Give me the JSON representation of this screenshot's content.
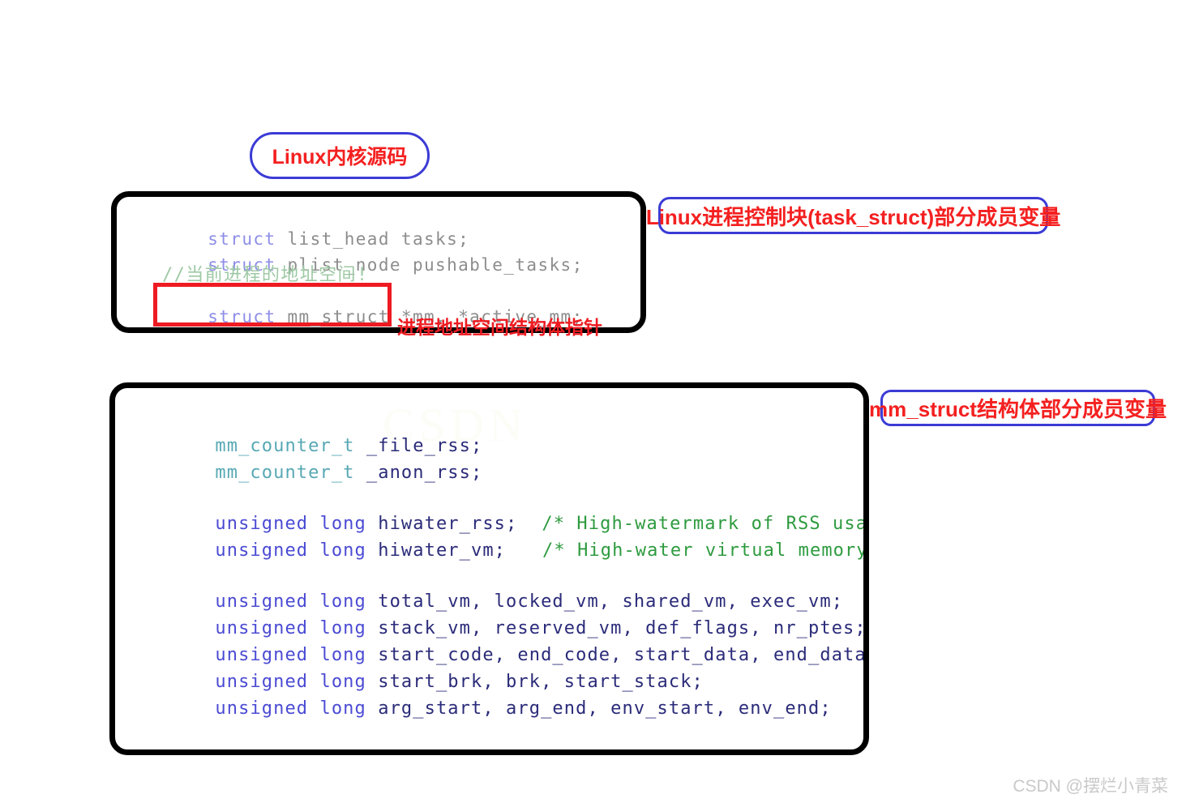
{
  "callouts": {
    "kernel_source": "Linux内核源码",
    "task_struct": "Linux进程控制块(task_struct)部分成员变量",
    "mm_struct": "mm_struct结构体部分成员变量"
  },
  "annotations": {
    "pointer_note": "进程地址空间结构体指针"
  },
  "task_struct_panel": {
    "lines": [
      {
        "keyword": "struct",
        "rest": " list_head tasks;"
      },
      {
        "keyword": "struct",
        "rest": " plist_node pushable_tasks;"
      },
      {
        "comment": "//当前进程的地址空间!"
      },
      {
        "keyword": "struct",
        "rest": " mm_struct *mm, *active_mm;"
      }
    ]
  },
  "mm_struct_panel": {
    "watermark": "CSDN",
    "lines": [
      {
        "type": "mm_counter_t",
        "decl": " _file_rss;",
        "comment": ""
      },
      {
        "type": "mm_counter_t",
        "decl": " _anon_rss;",
        "comment": ""
      },
      {
        "type": "unsigned long",
        "decl": " hiwater_rss;",
        "comment": "/* High-watermark of RSS usage */"
      },
      {
        "type": "unsigned long",
        "decl": " hiwater_vm;",
        "comment": "/* High-water virtual memory usage */"
      },
      {
        "type": "unsigned long",
        "decl": " total_vm, locked_vm, shared_vm, exec_vm;",
        "comment": ""
      },
      {
        "type": "unsigned long",
        "decl": " stack_vm, reserved_vm, def_flags, nr_ptes;",
        "comment": ""
      },
      {
        "type": "unsigned long",
        "decl": " start_code, end_code, start_data, end_data;",
        "comment": ""
      },
      {
        "type": "unsigned long",
        "decl": " start_brk, brk, start_stack;",
        "comment": ""
      },
      {
        "type": "unsigned long",
        "decl": " arg_start, arg_end, env_start, env_end;",
        "comment": ""
      }
    ]
  },
  "footer": {
    "watermark": "CSDN @摆烂小青菜"
  },
  "colors": {
    "callout_border": "#3b3bd6",
    "callout_text": "#f42020",
    "panel_border": "#000000",
    "red_highlight": "#ee1b22",
    "keyword_struct": "#8e8ee8",
    "keyword_unsigned": "#4b4bd4",
    "type_counter": "#57a8b4",
    "variable": "#2b2b7a",
    "comment_green": "#2e9b3f",
    "comment_light_green": "#9ec9a4",
    "plain_grey": "#8d8d8d"
  }
}
